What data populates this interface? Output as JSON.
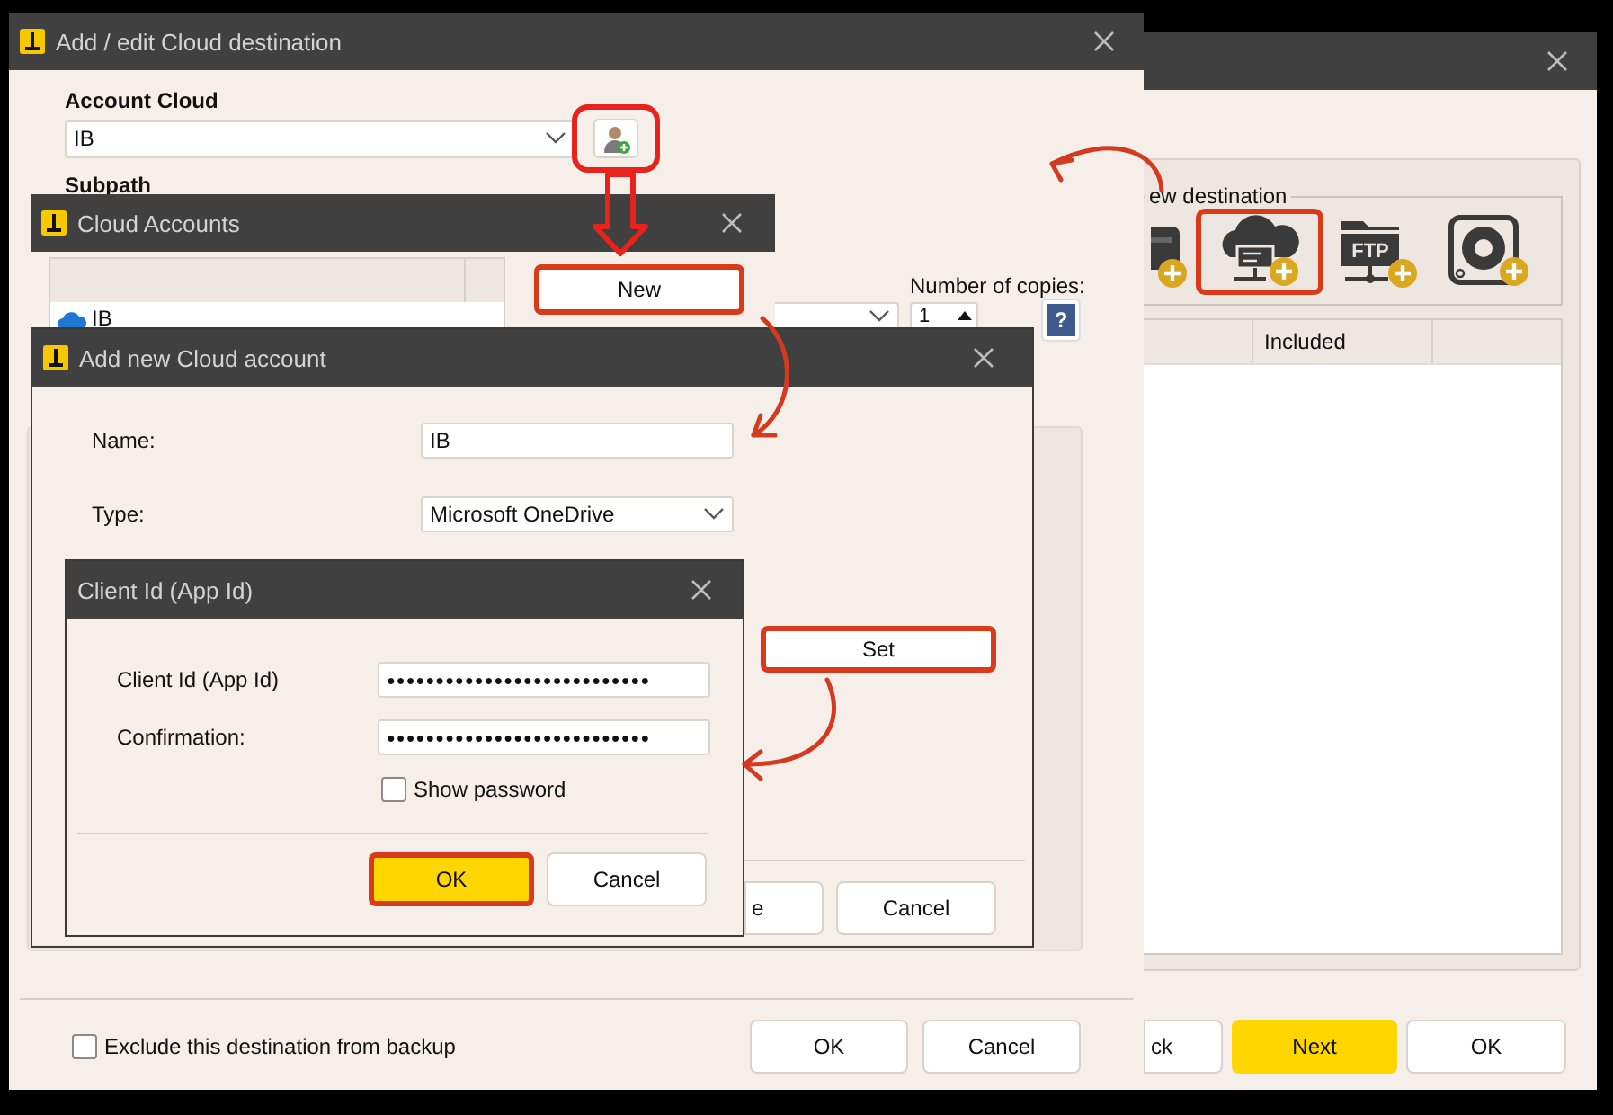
{
  "wizard_window": {
    "group_label": "ew destination",
    "destination_types": [
      {
        "kind": "drive",
        "highlighted": false
      },
      {
        "kind": "cloud",
        "highlighted": true
      },
      {
        "kind": "ftp",
        "label": "FTP",
        "highlighted": false
      },
      {
        "kind": "disc",
        "highlighted": false
      }
    ],
    "table_columns": [
      "Included"
    ],
    "buttons": [
      {
        "label": "ck",
        "kind": "normal"
      },
      {
        "label": "Next",
        "kind": "primary"
      },
      {
        "label": "OK",
        "kind": "normal"
      }
    ]
  },
  "destination_window": {
    "title": "Add / edit Cloud destination",
    "account_label": "Account Cloud",
    "account_value": "IB",
    "add_account_highlighted": true,
    "subpath_label": "Subpath",
    "copies_label": "Number of copies:",
    "copies_value": "1",
    "help_label": "?",
    "exclude": {
      "label": "Exclude this destination from backup",
      "checked": false
    },
    "buttons": [
      {
        "label": "OK"
      },
      {
        "label": "Cancel"
      }
    ]
  },
  "accounts_window": {
    "title": "Cloud Accounts",
    "rows": [
      {
        "name": "IB"
      }
    ],
    "new_button": {
      "label": "New",
      "highlighted": true
    }
  },
  "new_account_window": {
    "title": "Add new Cloud account",
    "name_label": "Name:",
    "name_value": "IB",
    "type_label": "Type:",
    "type_value": "Microsoft OneDrive",
    "set_button": {
      "label": "Set",
      "highlighted": true
    },
    "buttons": [
      {
        "label": "e"
      },
      {
        "label": "Cancel"
      }
    ]
  },
  "client_window": {
    "title": "Client Id (App Id)",
    "fields": [
      {
        "label": "Client Id (App Id)",
        "value": "●●●●●●●●●●●●●●●●●●●●●●●●●●●"
      },
      {
        "label": "Confirmation:",
        "value": "●●●●●●●●●●●●●●●●●●●●●●●●●●●"
      }
    ],
    "show_password": {
      "label": "Show password",
      "checked": false
    },
    "buttons": [
      {
        "label": "OK",
        "kind": "primary",
        "highlighted": true
      },
      {
        "label": "Cancel",
        "kind": "normal",
        "highlighted": false
      }
    ]
  }
}
